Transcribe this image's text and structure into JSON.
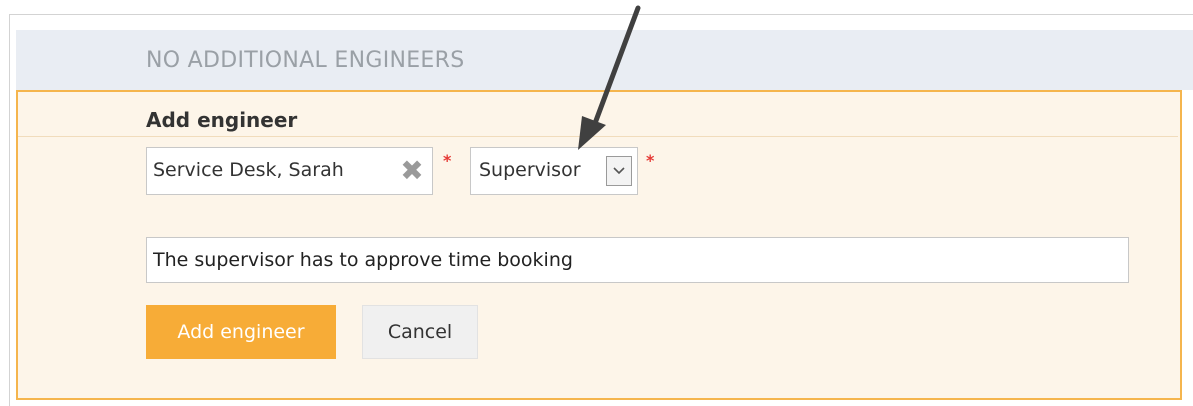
{
  "header": {
    "text": "NO ADDITIONAL ENGINEERS"
  },
  "form": {
    "title": "Add engineer",
    "engineer_value": "Service Desk, Sarah",
    "required_marker": "*",
    "role_value": "Supervisor",
    "note_value": "The supervisor has to approve time booking"
  },
  "buttons": {
    "add_label": "Add engineer",
    "cancel_label": "Cancel"
  },
  "icons": {
    "clear": "close-icon",
    "dropdown": "chevron-down-icon",
    "annotation": "arrow-icon"
  },
  "colors": {
    "accent": "#f7ac37",
    "panel_bg": "#fdf5e9",
    "panel_border": "#f5b54d",
    "header_bg": "#e9edf3",
    "required": "#e53935"
  }
}
